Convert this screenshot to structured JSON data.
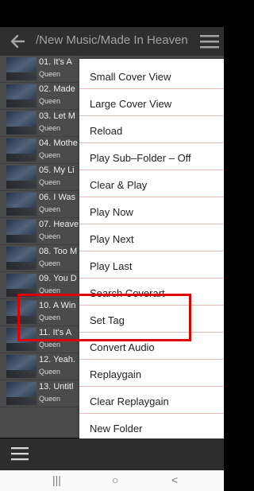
{
  "app": {
    "path": "/New Music/Made In Heaven"
  },
  "tracks": [
    {
      "title": "01. It's A",
      "artist": "Queen"
    },
    {
      "title": "02. Made",
      "artist": "Queen"
    },
    {
      "title": "03. Let M",
      "artist": "Queen"
    },
    {
      "title": "04. Mothe",
      "artist": "Queen"
    },
    {
      "title": "05. My Li",
      "artist": "Queen"
    },
    {
      "title": "06. I Was",
      "artist": "Queen"
    },
    {
      "title": "07. Heave",
      "artist": "Queen"
    },
    {
      "title": "08. Too M",
      "artist": "Queen"
    },
    {
      "title": "09. You D",
      "artist": "Queen"
    },
    {
      "title": "10. A Win",
      "artist": "Queen"
    },
    {
      "title": "11. It's A",
      "artist": "Queen"
    },
    {
      "title": "12. Yeah.",
      "artist": "Queen"
    },
    {
      "title": "13. Untitl",
      "artist": "Queen"
    }
  ],
  "menu": {
    "items": [
      "Small Cover View",
      "Large Cover View",
      "Reload",
      "Play Sub–Folder – Off",
      "Clear & Play",
      "Play Now",
      "Play Next",
      "Play Last",
      "Search Coverart",
      "Set Tag",
      "Convert Audio",
      "Replaygain",
      "Clear Replaygain",
      "New Folder"
    ],
    "highlighted_item": "Set Tag",
    "highlight_color": "#e00000"
  },
  "nav": {
    "recent": "|||",
    "home": "○",
    "back": "<"
  },
  "colors": {
    "topbar": "#2f2f2f",
    "list_bg": "#4b4b4b",
    "menu_bg": "#ffffff",
    "menu_separator": "#e6b8b8"
  }
}
